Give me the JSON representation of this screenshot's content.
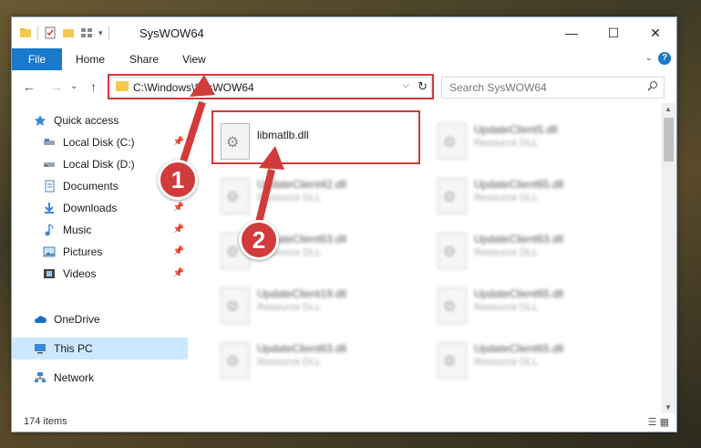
{
  "window": {
    "title": "SysWOW64",
    "controls": {
      "minimize": "—",
      "maximize": "☐",
      "close": "✕"
    }
  },
  "ribbon": {
    "tabs": [
      "File",
      "Home",
      "Share",
      "View"
    ],
    "help": "?"
  },
  "address_bar": {
    "path": "C:\\Windows\\SysWOW64",
    "dropdown": "⌵",
    "refresh": "↻"
  },
  "nav_buttons": {
    "back": "←",
    "forward": "→",
    "up": "↑",
    "recent": "⌄"
  },
  "search": {
    "placeholder": "Search SysWOW64",
    "icon": "search-icon"
  },
  "sidebar": {
    "items": [
      {
        "label": "Quick access",
        "icon": "star-icon",
        "pinned": false
      },
      {
        "label": "Local Disk (C:)",
        "icon": "drive-icon",
        "pinned": true
      },
      {
        "label": "Local Disk (D:)",
        "icon": "drive-icon",
        "pinned": false
      },
      {
        "label": "Documents",
        "icon": "documents-icon",
        "pinned": true
      },
      {
        "label": "Downloads",
        "icon": "downloads-icon",
        "pinned": true
      },
      {
        "label": "Music",
        "icon": "music-icon",
        "pinned": true
      },
      {
        "label": "Pictures",
        "icon": "pictures-icon",
        "pinned": true
      },
      {
        "label": "Videos",
        "icon": "videos-icon",
        "pinned": true
      },
      {
        "label": "OneDrive",
        "icon": "cloud-icon",
        "pinned": false
      },
      {
        "label": "This PC",
        "icon": "computer-icon",
        "pinned": false,
        "selected": true
      },
      {
        "label": "Network",
        "icon": "network-icon",
        "pinned": false
      }
    ]
  },
  "files": {
    "col1": [
      {
        "name": "libmatlb.dll",
        "desc": ""
      },
      {
        "name": "UpdateClient42.dll",
        "desc": "Resource DLL"
      },
      {
        "name": "UpdateClient63.dll",
        "desc": "Resource DLL"
      },
      {
        "name": "UpdateClient19.dll",
        "desc": "Resource DLL"
      },
      {
        "name": "UpdateClient63.dll",
        "desc": "Resource DLL"
      }
    ],
    "col2": [
      {
        "name": "UpdateClient5.dll",
        "desc": "Resource DLL"
      },
      {
        "name": "UpdateClient65.dll",
        "desc": "Resource DLL"
      },
      {
        "name": "UpdateClient63.dll",
        "desc": "Resource DLL"
      },
      {
        "name": "UpdateClient65.dll",
        "desc": "Resource DLL"
      },
      {
        "name": "UpdateClient65.dll",
        "desc": "Resource DLL"
      }
    ]
  },
  "status": {
    "item_count": "174 items"
  },
  "callouts": [
    "1",
    "2"
  ],
  "colors": {
    "accent": "#1979ca",
    "highlight": "#cf3b3b",
    "selected": "#cce8ff"
  }
}
